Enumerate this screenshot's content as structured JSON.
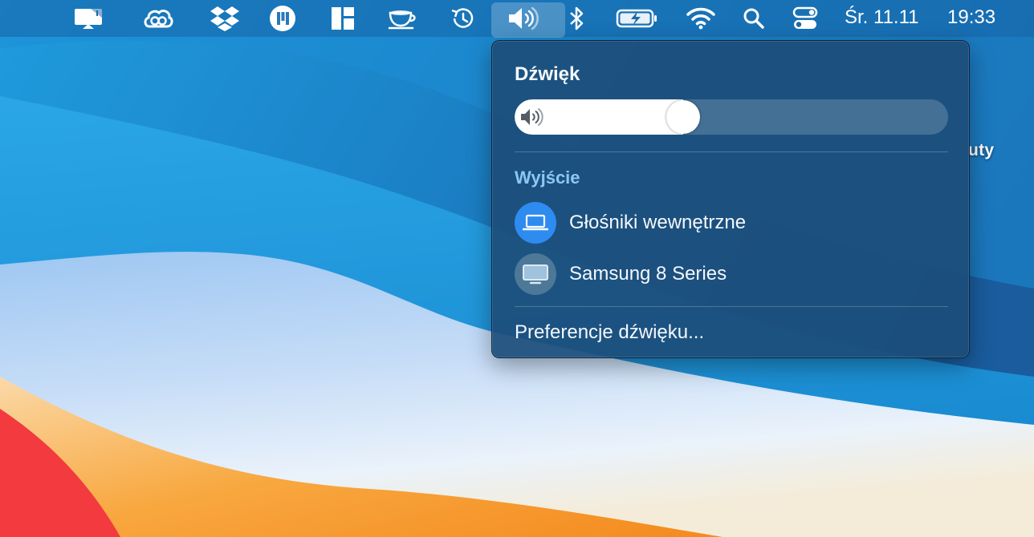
{
  "menubar": {
    "icons": [
      "display-mirroring-icon",
      "creative-cloud-icon",
      "dropbox-icon",
      "app-m-icon",
      "window-layout-icon",
      "coffee-cup-icon",
      "time-machine-icon",
      "volume-icon",
      "bluetooth-icon",
      "battery-charging-icon",
      "wifi-icon",
      "spotlight-search-icon",
      "control-center-icon"
    ],
    "date": "Śr. 11.11",
    "time": "19:33"
  },
  "desktop": {
    "partial_label": "uty"
  },
  "sound_panel": {
    "title": "Dźwięk",
    "volume_level": 0.38,
    "output_heading": "Wyjście",
    "devices": [
      {
        "label": "Głośniki wewnętrzne",
        "icon": "laptop-icon",
        "selected": true
      },
      {
        "label": "Samsung 8 Series",
        "icon": "monitor-icon",
        "selected": false
      }
    ],
    "preferences_label": "Preferencje dźwięku..."
  },
  "colors": {
    "selected_device": "#2e8bf0",
    "unselected_device": "#4d7898",
    "output_heading": "#8cc8f0"
  }
}
